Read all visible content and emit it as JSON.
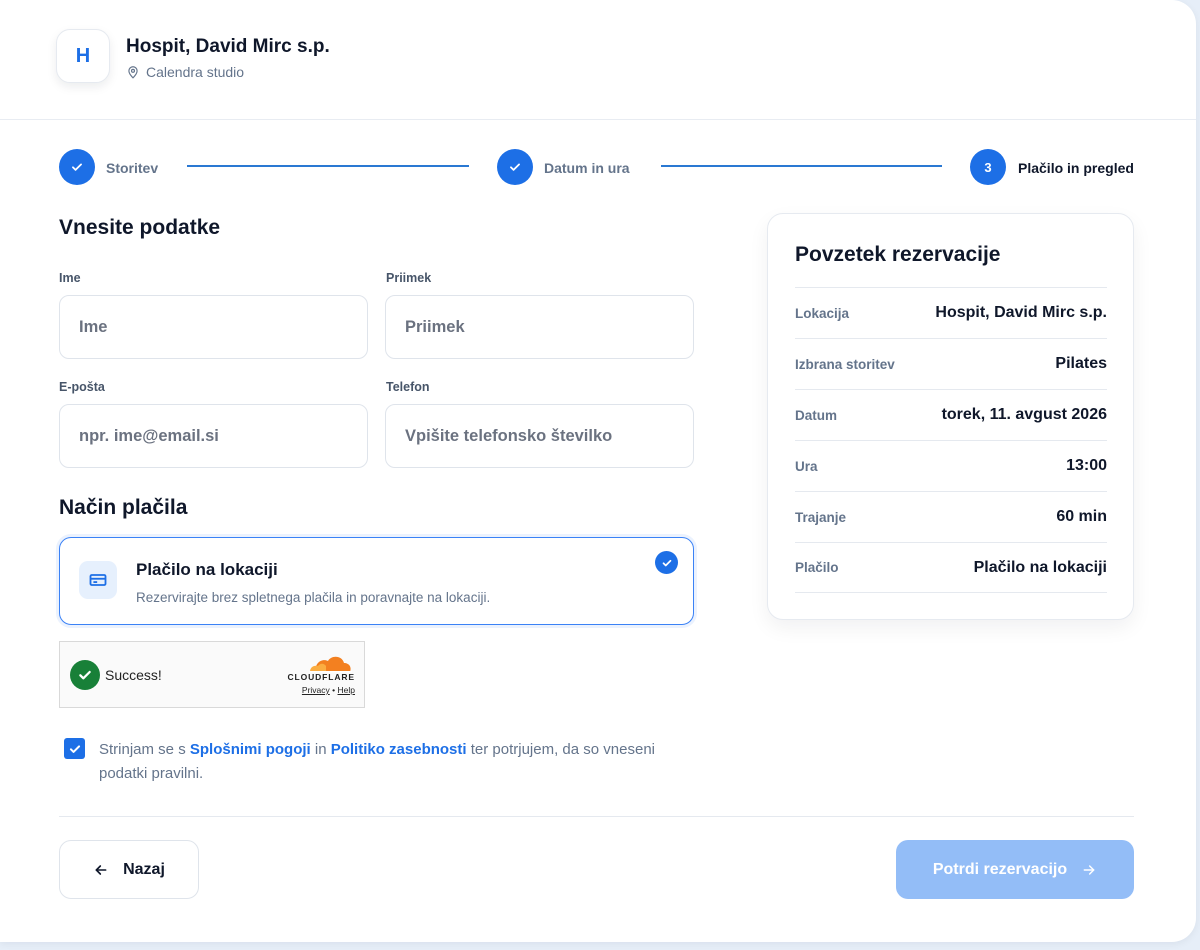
{
  "business": {
    "logo_letter": "H",
    "name": "Hospit, David Mirc s.p.",
    "location": "Calendra studio"
  },
  "steps": [
    {
      "number": "1",
      "label": "Storitev",
      "state": "done"
    },
    {
      "number": "2",
      "label": "Datum in ura",
      "state": "done"
    },
    {
      "number": "3",
      "label": "Plačilo in pregled",
      "state": "active"
    }
  ],
  "form": {
    "title": "Vnesite podatke",
    "first_name": {
      "label": "Ime",
      "placeholder": "Ime",
      "value": ""
    },
    "last_name": {
      "label": "Priimek",
      "placeholder": "Priimek",
      "value": ""
    },
    "email": {
      "label": "E-pošta",
      "placeholder": "npr. ime@email.si",
      "value": ""
    },
    "phone": {
      "label": "Telefon",
      "placeholder": "Vpišite telefonsko številko",
      "value": ""
    }
  },
  "payment": {
    "title": "Način plačila",
    "option": {
      "title": "Plačilo na lokaciji",
      "description": "Rezervirajte brez spletnega plačila in poravnajte na lokaciji.",
      "selected": true
    }
  },
  "captcha": {
    "status": "Success!",
    "brand": "CLOUDFLARE",
    "privacy": "Privacy",
    "separator": "•",
    "help": "Help"
  },
  "consent": {
    "checked": true,
    "text_1": "Strinjam se s ",
    "link_terms": "Splošnimi pogoji",
    "text_2": " in ",
    "link_privacy": "Politiko zasebnosti",
    "text_3": " ter potrjujem, da so vneseni podatki pravilni."
  },
  "actions": {
    "back": "Nazaj",
    "confirm": "Potrdi rezervacijo"
  },
  "summary": {
    "title": "Povzetek rezervacije",
    "rows": [
      {
        "label": "Lokacija",
        "value": "Hospit, David Mirc s.p."
      },
      {
        "label": "Izbrana storitev",
        "value": "Pilates"
      },
      {
        "label": "Datum",
        "value": "torek, 11. avgust 2026"
      },
      {
        "label": "Ura",
        "value": "13:00"
      },
      {
        "label": "Trajanje",
        "value": "60 min"
      },
      {
        "label": "Plačilo",
        "value": "Plačilo na lokaciji"
      }
    ]
  },
  "colors": {
    "accent": "#1d6fe6",
    "confirm_disabled": "#93bdf7",
    "captcha_success": "#188038",
    "cloudflare_orange": "#f38020"
  }
}
